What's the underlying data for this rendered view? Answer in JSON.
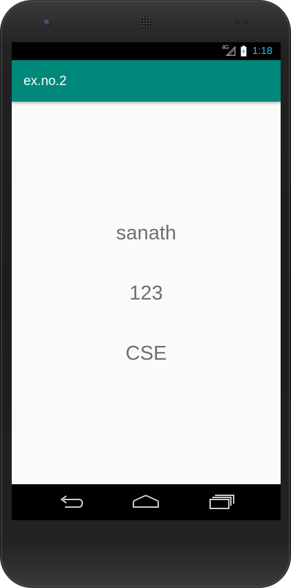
{
  "device": {
    "bezel_color": "#1c1c1c"
  },
  "status_bar": {
    "network_type": "4G",
    "time": "1:18",
    "time_color": "#33b5e5",
    "signal_icon": "signal-icon",
    "battery_icon": "battery-charging-icon"
  },
  "app_bar": {
    "title": "ex.no.2",
    "color": "#00897b"
  },
  "content": {
    "lines": [
      "sanath",
      "123",
      "CSE"
    ],
    "text_color": "#6f6f6f",
    "background": "#fafafa"
  },
  "nav_bar": {
    "buttons": [
      "back-icon",
      "home-icon",
      "recents-icon"
    ]
  }
}
